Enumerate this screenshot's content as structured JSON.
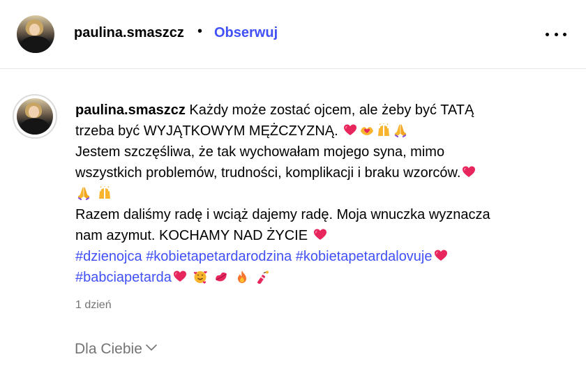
{
  "header": {
    "username": "paulina.smaszcz",
    "separator": "•",
    "follow_label": "Obserwuj"
  },
  "post": {
    "username": "paulina.smaszcz",
    "lines": [
      "Każdy może zostać ojcem, ale żeby być TATĄ",
      "trzeba być WYJĄTKOWYM MĘŻCZYZNĄ.",
      "Jestem szczęśliwa, że tak wychowałam mojego syna, mimo",
      "wszystkich problemów, trudności, komplikacji i braku wzorców.",
      "Razem daliśmy radę i wciąż dajemy radę. Moja wnuczka wyznacza",
      "nam azymut. KOCHAMY NAD ŻYCIE"
    ],
    "hashtags": [
      "#dzienojca",
      "#kobietapetardarodzina",
      "#kobietapetardalovuje",
      "#babciapetarda"
    ],
    "timestamp": "1 dzień"
  },
  "footer": {
    "for_you_label": "Dla Ciebie"
  },
  "colors": {
    "link": "#4150f7",
    "muted": "#737373",
    "divider": "#e8e8e8"
  }
}
